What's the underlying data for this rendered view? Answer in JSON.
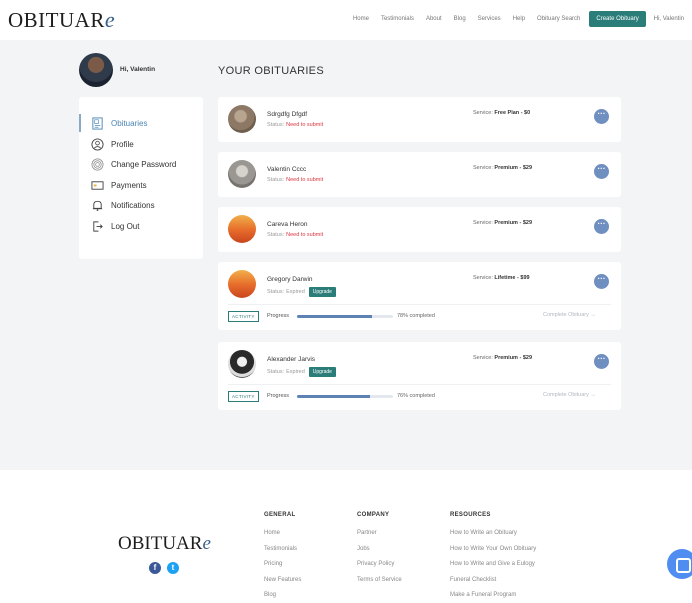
{
  "header": {
    "logo_main": "OBITUAR",
    "logo_suffix": "e",
    "nav": [
      "Home",
      "Testimonials",
      "About",
      "Blog",
      "Services",
      "Help",
      "Obituary Search"
    ],
    "cta": "Create Obituary",
    "greeting": "Hi, Valentin"
  },
  "profile": {
    "hello": "Hi, Valentin"
  },
  "page": {
    "title": "YOUR OBITUARIES"
  },
  "sidebar": {
    "items": [
      {
        "label": "Obituaries",
        "icon": "document-icon"
      },
      {
        "label": "Profile",
        "icon": "person-icon"
      },
      {
        "label": "Change Password",
        "icon": "fingerprint-icon"
      },
      {
        "label": "Payments",
        "icon": "card-icon"
      },
      {
        "label": "Notifications",
        "icon": "bell-icon"
      },
      {
        "label": "Log Out",
        "icon": "logout-icon"
      }
    ]
  },
  "obituaries": [
    {
      "name": "Sdrgdfg Dfgdf",
      "status_label": "Status:",
      "status": "Need to submit",
      "service_label": "Service:",
      "service": "Free Plan - $0"
    },
    {
      "name": "Valentin Cccc",
      "status_label": "Status:",
      "status": "Need to submit",
      "service_label": "Service:",
      "service": "Premium - $29"
    },
    {
      "name": "Careva Heron",
      "status_label": "Status:",
      "status": "Need to submit",
      "service_label": "Service:",
      "service": "Premium - $29"
    },
    {
      "name": "Gregory Darwin",
      "status_label": "Status:",
      "status": "Expired",
      "upgrade": "Upgrade",
      "service_label": "Service:",
      "service": "Lifetime - $99",
      "activity": "ACTIVITY",
      "progress_label": "Progress",
      "progress_pct": 78,
      "progress_text": "78% completed",
      "complete_link": "Complete Obituary"
    },
    {
      "name": "Alexander Jarvis",
      "status_label": "Status:",
      "status": "Expired",
      "upgrade": "Upgrade",
      "service_label": "Service:",
      "service": "Premium - $29",
      "activity": "ACTIVITY",
      "progress_label": "Progress",
      "progress_pct": 76,
      "progress_text": "76% completed",
      "complete_link": "Complete Obituary"
    }
  ],
  "footer": {
    "logo_main": "OBITUAR",
    "logo_suffix": "e",
    "social": [
      {
        "label": "f",
        "icon": "facebook-icon",
        "color": "#3b5998"
      },
      {
        "label": "t",
        "icon": "twitter-icon",
        "color": "#1da1f2"
      }
    ],
    "general": {
      "title": "GENERAL",
      "links": [
        "Home",
        "Testimonials",
        "Pricing",
        "New Features",
        "Blog"
      ]
    },
    "company": {
      "title": "COMPANY",
      "links": [
        "Partner",
        "Jobs",
        "Privacy Policy",
        "Terms of Service"
      ]
    },
    "resources": {
      "title": "RESOURCES",
      "links": [
        "How to Write an Obituary",
        "How to Write Your Own Obituary",
        "How to Write and Give a Eulogy",
        "Funeral Checklist",
        "Make a Funeral Program"
      ]
    }
  },
  "colors": {
    "accent": "#2b7d7a",
    "brand_blue": "#4a86b7",
    "error": "#d9363e",
    "progress": "#5d83b6"
  }
}
